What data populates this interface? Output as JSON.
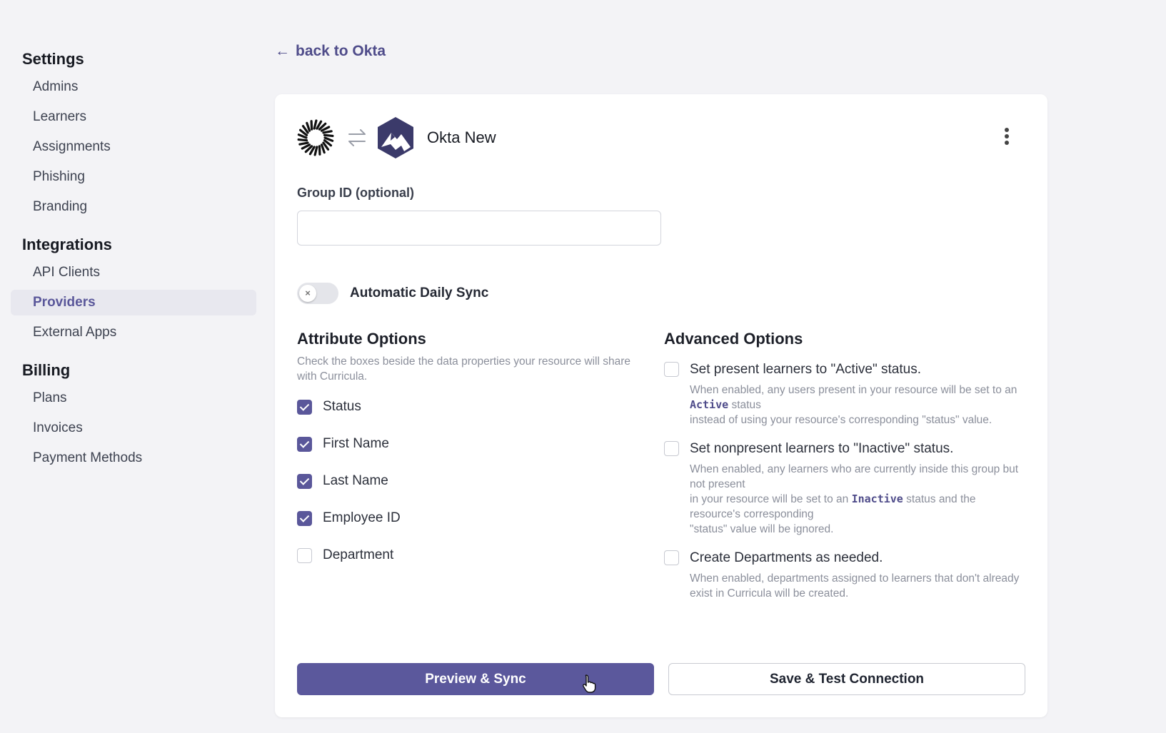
{
  "sidebar": {
    "sections": [
      {
        "title": "Settings",
        "items": [
          "Admins",
          "Learners",
          "Assignments",
          "Phishing",
          "Branding"
        ]
      },
      {
        "title": "Integrations",
        "items": [
          "API Clients",
          "Providers",
          "External Apps"
        ]
      },
      {
        "title": "Billing",
        "items": [
          "Plans",
          "Invoices",
          "Payment Methods"
        ]
      }
    ],
    "active_item": "Providers"
  },
  "back_link": {
    "label": "back to Okta",
    "icon": "arrow-left-icon"
  },
  "provider": {
    "name": "Okta New",
    "icons": [
      "curricula-sun-icon",
      "swap-arrows-icon",
      "okta-mountain-icon",
      "kebab-menu-icon"
    ]
  },
  "group_id": {
    "label": "Group ID (optional)",
    "value": "",
    "placeholder": ""
  },
  "daily_sync": {
    "label": "Automatic Daily Sync",
    "enabled": false
  },
  "attributes": {
    "title": "Attribute Options",
    "description": "Check the boxes beside the data properties your resource will share with Curricula.",
    "options": [
      {
        "label": "Status",
        "checked": true
      },
      {
        "label": "First Name",
        "checked": true
      },
      {
        "label": "Last Name",
        "checked": true
      },
      {
        "label": "Employee ID",
        "checked": true
      },
      {
        "label": "Department",
        "checked": false
      }
    ]
  },
  "advanced": {
    "title": "Advanced Options",
    "opt1": {
      "title": "Set present learners to \"Active\" status.",
      "desc_pre": "When enabled, any users present in your resource will be set to an",
      "code": "Active",
      "desc_post": "status",
      "desc_line2": "instead of using your resource's corresponding \"status\" value.",
      "checked": false
    },
    "opt2": {
      "title": "Set nonpresent learners to \"Inactive\" status.",
      "desc_pre": "When enabled, any learners who are currently inside this group but not present",
      "desc_pre2": "in your resource will be set to an",
      "code": "Inactive",
      "desc_post": "status and the resource's corresponding",
      "desc_line3": "\"status\" value will be ignored.",
      "checked": false
    },
    "opt3": {
      "title": "Create Departments as needed.",
      "desc_line1": "When enabled, departments assigned to learners that don't already",
      "desc_line2": "exist in Curricula will be created.",
      "checked": false
    }
  },
  "actions": {
    "primary": "Preview & Sync",
    "secondary": "Save & Test Connection"
  },
  "colors": {
    "accent": "#5b589c",
    "background": "#f3f3f6",
    "card": "#ffffff"
  }
}
